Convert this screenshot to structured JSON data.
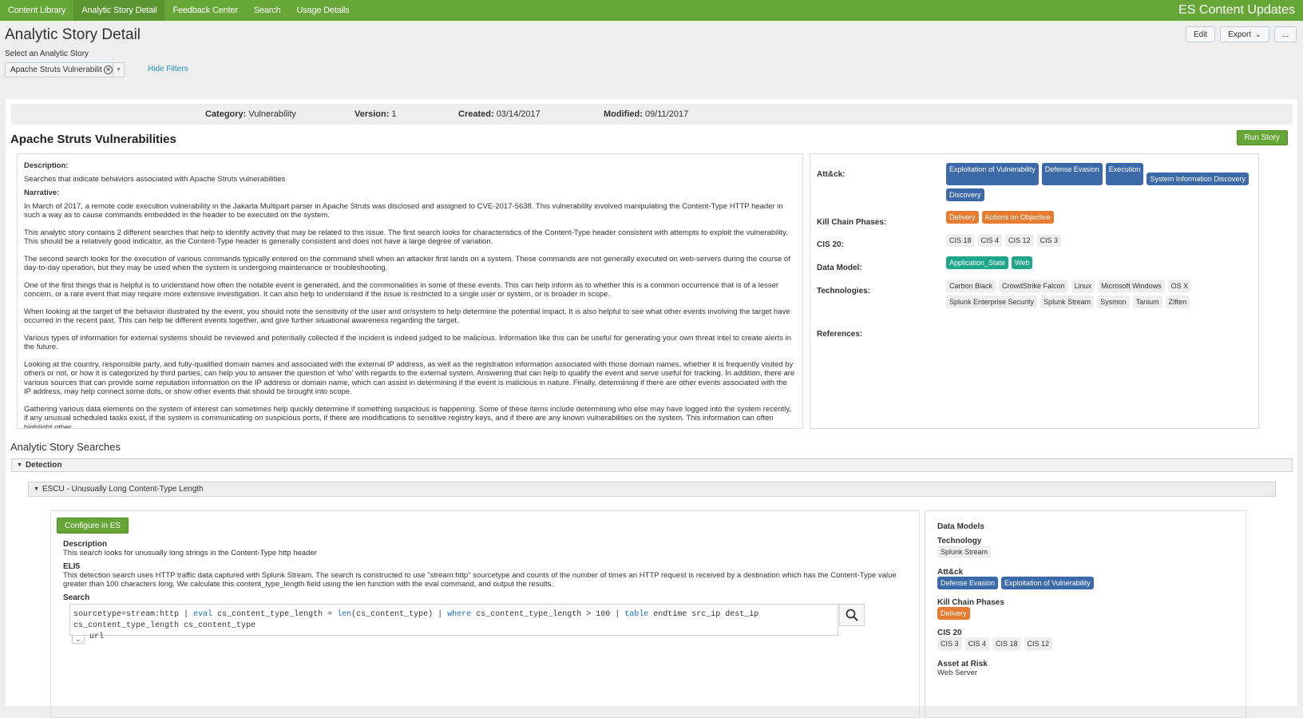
{
  "nav": {
    "items": [
      "Content Library",
      "Analytic Story Detail",
      "Feedback Center",
      "Search",
      "Usage Details"
    ],
    "active_index": 1,
    "app_title": "ES Content Updates"
  },
  "page": {
    "title": "Analytic Story Detail",
    "buttons": {
      "edit": "Edit",
      "export": "Export",
      "more": "..."
    },
    "select_label": "Select an Analytic Story",
    "selected_story": "Apache Struts Vulnerabilit...",
    "hide_filters": "Hide Filters"
  },
  "meta": {
    "category_label": "Category:",
    "category": "Vulnerability",
    "version_label": "Version:",
    "version": "1",
    "created_label": "Created:",
    "created": "03/14/2017",
    "modified_label": "Modified:",
    "modified": "09/11/2017"
  },
  "story": {
    "name": "Apache Struts Vulnerabilities",
    "run_button": "Run Story",
    "description_label": "Description:",
    "description": "Searches that indicate behaviors associated with Apache Struts vulnerabilities",
    "narrative_label": "Narrative:",
    "narrative": [
      "In March of 2017, a remote code execution vulnerability in the Jakarta Multipart parser in Apache Struts was disclosed and assigned to CVE-2017-5638. This vulnerability involved manipulating the Content-Type HTTP header in such a way as to cause commands embedded in the header to be executed on the system.",
      "This analytic story contains 2 different searches that help to identify activity that may be related to this issue. The first search looks for characteristics of the Content-Type header consistent with attempts to exploit the vulnerability. This should be a relatively good indicator, as the Content-Type header is generally consistent and does not have a large degree of variation.",
      "The second search looks for the execution of various commands typically entered on the command shell when an attacker first lands on a system. These commands are not generally executed on web-servers during the course of day-to-day operation, but they may be used when the system is undergoing maintenance or troubleshooting.",
      "One of the first things that is helpful is to understand how often the notable event is generated, and the commonalities in some of these events. This can help inform as to whether this is a common occurrence that is of a lesser concern, or a rare event that may require more extensive investigation. It can also help to understand if the issue is restricted to a single user or system, or is broader in scope.",
      "When looking at the target of the behavior illustrated by the event, you should note the sensitivity of the user and or/system to help determine the potential impact. It is also helpful to see what other events involving the target have occurred in the recent past. This can help tie different events together, and give further situational awareness regarding the target.",
      "Various types of information for external systems should be reviewed and potentially collected if the incident is indeed judged to be malicious. Information like this can be useful for generating your own threat intel to create alerts in the future.",
      "Looking at the country, responsible party, and fully-qualified domain names and associated with the external IP address, as well as the registration information associated with those domain names, whether it is frequently visited by others or not, or how it is categorized by third parties, can help you to answer the question of 'who' with regards to the external system. Answering that can help to qualify the event and serve useful for tracking. In addition, there are various sources that can provide some reputation information on the IP address or domain name, which can assist in determining if the event is malicious in nature. Finally, determining if there are other events associated with the IP address, may help connect some dots, or show other events that should be brought into scope.",
      "Gathering various data elements on the system of interest can sometimes help quickly determine if something suspicious is happening. Some of these items include determining who else may have logged into the system recently, if any unusual scheduled tasks exist, if the system is communicating on suspicious ports, if there are modifications to sensitive registry keys, and if there are any known vulnerabilities on the system. This information can often highlight other"
    ]
  },
  "tags": {
    "attack_label": "Att&ck:",
    "attack": [
      "Exploitation of Vulnerability",
      "Defense Evasion",
      "Execution",
      "System Information Discovery",
      "Discovery"
    ],
    "kill_chain_label": "Kill Chain Phases:",
    "kill_chain": [
      "Delivery",
      "Actions on Objective"
    ],
    "cis_label": "CIS 20:",
    "cis": [
      "CIS 18",
      "CIS 4",
      "CIS 12",
      "CIS 3"
    ],
    "data_model_label": "Data Model:",
    "data_model": [
      "Application_State",
      "Web"
    ],
    "technologies_label": "Technologies:",
    "technologies": [
      "Carbon Black",
      "CrowdStrike Falcon",
      "Linux",
      "Microsoft Windows",
      "OS X",
      "Splunk Enterprise Security",
      "Splunk Stream",
      "Sysmon",
      "Tanium",
      "Ziften"
    ],
    "references_label": "References:"
  },
  "searches": {
    "title": "Analytic Story Searches",
    "detection_label": "Detection",
    "escu_title": "ESCU - Unusually Long Content-Type Length",
    "configure_button": "Configure in ES",
    "description_label": "Description",
    "description": "This search looks for unusually long strings in the Content-Type http header",
    "eli5_label": "ELI5",
    "eli5": "This detection search uses HTTP traffic data captured with Splunk Stream. The search is constructed to use \"stream:http\" sourcetype and counts of the number of times an HTTP request is received by a destination which has the Content-Type value greater than 100 characters long. We calculate this content_type_length field using the len function with the eval command, and output the results.",
    "search_label": "Search",
    "query": {
      "p1": "sourcetype=stream:http",
      "pipe1": " | ",
      "kw_eval": "eval",
      "p2": " cs_content_type_length = ",
      "kw_len": "len",
      "p3": "(cs_content_type)",
      "pipe2": " | ",
      "kw_where": "where",
      "p4": " cs_content_type_length > 100",
      "pipe3": " | ",
      "kw_table": "table",
      "p5": " endtime src_ip dest_ip cs_content_type_length cs_content_type",
      "line2": "url"
    },
    "right": {
      "data_models_label": "Data Models",
      "technology_label": "Technology",
      "technology": [
        "Splunk Stream"
      ],
      "attack_label": "Att&ck",
      "attack": [
        "Defense Evasion",
        "Exploitation of Vulnerability"
      ],
      "kill_chain_label": "Kill Chain Phases",
      "kill_chain": [
        "Delivery"
      ],
      "cis_label": "CIS 20",
      "cis": [
        "CIS 3",
        "CIS 4",
        "CIS 18",
        "CIS 12"
      ],
      "asset_label": "Asset at Risk",
      "asset": "Web Server"
    }
  }
}
